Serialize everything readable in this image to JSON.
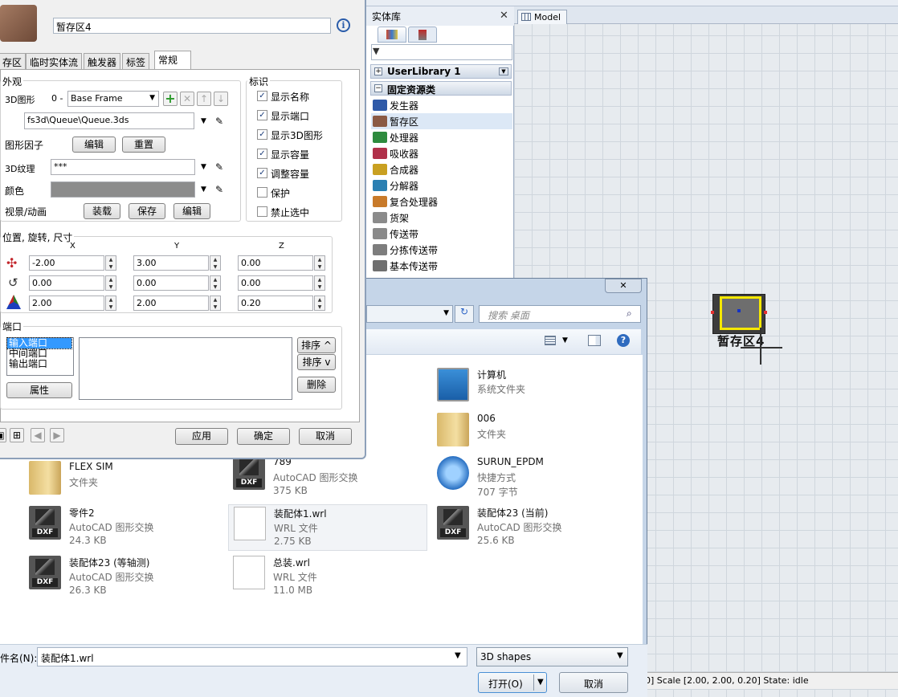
{
  "model": {
    "tab": "Model",
    "object_label": "暂存区4",
    "status": "0] Scale [2.00, 2.00, 0.20] State: idle"
  },
  "library": {
    "title": "实体库",
    "close": "✕",
    "groups": [
      "UserLibrary 1",
      "固定资源类"
    ],
    "items": [
      {
        "label": "发生器",
        "color": "#2f5aa8"
      },
      {
        "label": "暂存区",
        "color": "#8b5a44"
      },
      {
        "label": "处理器",
        "color": "#2e8b3e"
      },
      {
        "label": "吸收器",
        "color": "#b0314a"
      },
      {
        "label": "合成器",
        "color": "#c9a021"
      },
      {
        "label": "分解器",
        "color": "#2a7fb2"
      },
      {
        "label": "复合处理器",
        "color": "#c87a2a"
      },
      {
        "label": "货架",
        "color": "#8b8b8b"
      },
      {
        "label": "传送带",
        "color": "#8a8a8a"
      },
      {
        "label": "分拣传送带",
        "color": "#7d7d7d"
      },
      {
        "label": "基本传送带",
        "color": "#6f6f6f"
      }
    ]
  },
  "file_dialog": {
    "close": "✕",
    "search_placeholder": "搜索 桌面",
    "refresh": "↻",
    "search_icon": "⌕",
    "files": [
      {
        "name": "计算机",
        "type": "系统文件夹",
        "size": "",
        "icon": "computer-icon"
      },
      {
        "name": "006",
        "type": "文件夹",
        "size": "",
        "icon": "folder-icon"
      },
      {
        "name": "FLEX SIM",
        "type": "文件夹",
        "size": "",
        "icon": "folder-icon"
      },
      {
        "name": "789",
        "type": "AutoCAD 图形交换",
        "size": "375 KB",
        "icon": "dxf-icon"
      },
      {
        "name": "SURUN_EPDM",
        "type": "快捷方式",
        "size": "707 字节",
        "icon": "shortcut-icon"
      },
      {
        "name": "零件2",
        "type": "AutoCAD 图形交换",
        "size": "24.3 KB",
        "icon": "dxf-icon"
      },
      {
        "name": "装配体1.wrl",
        "type": "WRL 文件",
        "size": "2.75 KB",
        "icon": "doc-icon"
      },
      {
        "name": "装配体23 (当前)",
        "type": "AutoCAD 图形交换",
        "size": "25.6 KB",
        "icon": "dxf-icon"
      },
      {
        "name": "装配体23 (等轴测)",
        "type": "AutoCAD 图形交换",
        "size": "26.3 KB",
        "icon": "dxf-icon"
      },
      {
        "name": "总装.wrl",
        "type": "WRL 文件",
        "size": "11.0 MB",
        "icon": "doc-icon"
      }
    ],
    "filename_label": "件名(N):",
    "filename_value": "装配体1.wrl",
    "filetype": "3D shapes",
    "open_label": "打开(O)",
    "cancel_label": "取消"
  },
  "props": {
    "object_name": "暂存区4",
    "info": "i",
    "tabs": [
      "存区",
      "临时实体流",
      "触发器",
      "标签",
      "常规"
    ],
    "appearance": {
      "title": "外观",
      "shape_label": "3D图形",
      "shape_index": "0 -",
      "shape_frame": "Base Frame",
      "shape_path": "fs3d\\Queue\\Queue.3ds",
      "factor_label": "图形因子",
      "edit": "编辑",
      "reset": "重置",
      "texture_label": "3D纹理",
      "texture_value": "***",
      "color_label": "颜色",
      "color_value": "#8c8c8c",
      "view_label": "视景/动画",
      "load": "装载",
      "save": "保存",
      "edit2": "编辑"
    },
    "flags": {
      "title": "标识",
      "items": [
        {
          "label": "显示名称",
          "checked": "✓"
        },
        {
          "label": "显示端口",
          "checked": "✓"
        },
        {
          "label": "显示3D图形",
          "checked": "✓"
        },
        {
          "label": "显示容量",
          "checked": "✓"
        },
        {
          "label": "调整容量",
          "checked": "✓"
        },
        {
          "label": "保护",
          "checked": ""
        },
        {
          "label": "禁止选中",
          "checked": ""
        }
      ]
    },
    "position": {
      "title": "位置, 旋转, 尺寸",
      "x": "X",
      "y": "Y",
      "z": "Z",
      "pos": [
        "-2.00",
        "3.00",
        "0.00"
      ],
      "rot": [
        "0.00",
        "0.00",
        "0.00"
      ],
      "size": [
        "2.00",
        "2.00",
        "0.20"
      ]
    },
    "ports": {
      "title": "端口",
      "list": [
        "输入端口",
        "中间端口",
        "输出端口"
      ],
      "props": "属性",
      "sort_up": "排序 ^",
      "sort_down": "排序 v",
      "delete": "删除"
    },
    "footer": {
      "apply": "应用",
      "ok": "确定",
      "cancel": "取消"
    }
  }
}
